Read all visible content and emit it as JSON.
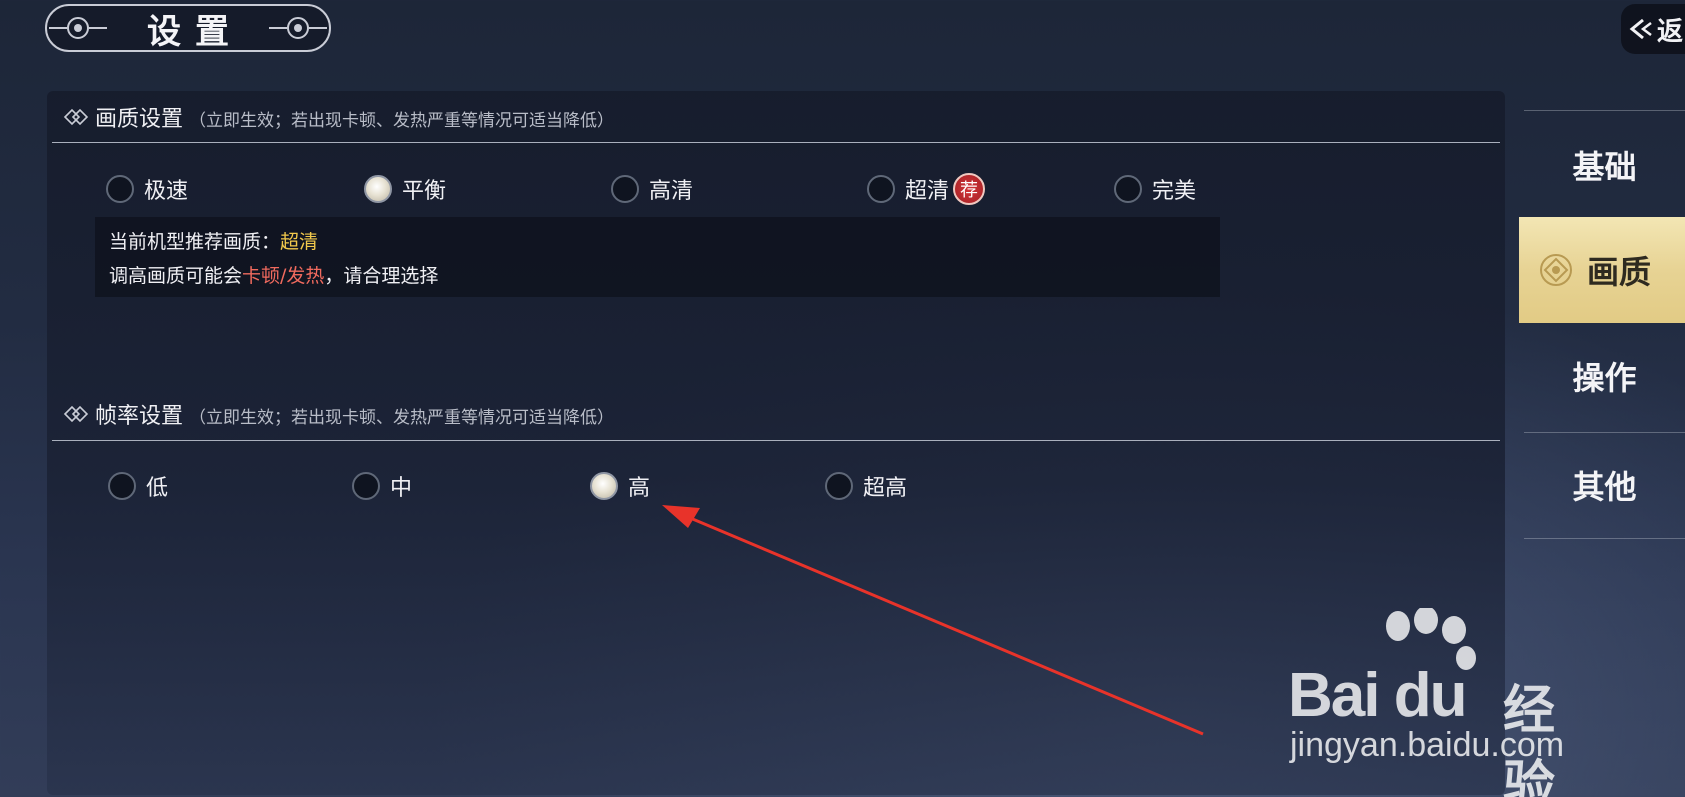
{
  "header": {
    "title": "设置",
    "back_label": "返"
  },
  "quality": {
    "title": "画质设置",
    "subtitle": "（立即生效；若出现卡顿、发热严重等情况可适当降低）",
    "options": [
      "极速",
      "平衡",
      "高清",
      "超清",
      "完美"
    ],
    "selected": "平衡",
    "recommend_badge": "荐",
    "info_line1_prefix": "当前机型推荐画质：",
    "info_line1_value": "超清",
    "info_line2_prefix": "调高画质可能会",
    "info_line2_warn": "卡顿/发热",
    "info_line2_suffix": "，请合理选择"
  },
  "framerate": {
    "title": "帧率设置",
    "subtitle": "（立即生效；若出现卡顿、发热严重等情况可适当降低）",
    "options": [
      "低",
      "中",
      "高",
      "超高"
    ],
    "selected": "高"
  },
  "sidebar": {
    "items": [
      {
        "label": "基础",
        "active": false
      },
      {
        "label": "画质",
        "active": true
      },
      {
        "label": "操作",
        "active": false
      },
      {
        "label": "其他",
        "active": false
      }
    ]
  },
  "watermark": {
    "logo": "Bai du",
    "logo_suffix": "经验",
    "url": "jingyan.baidu.com"
  },
  "colors": {
    "accent_gold": "#e7d394",
    "highlight_yellow": "#f2c94c",
    "warning_red": "#f06a5e",
    "annotation_arrow": "#e8332a"
  }
}
